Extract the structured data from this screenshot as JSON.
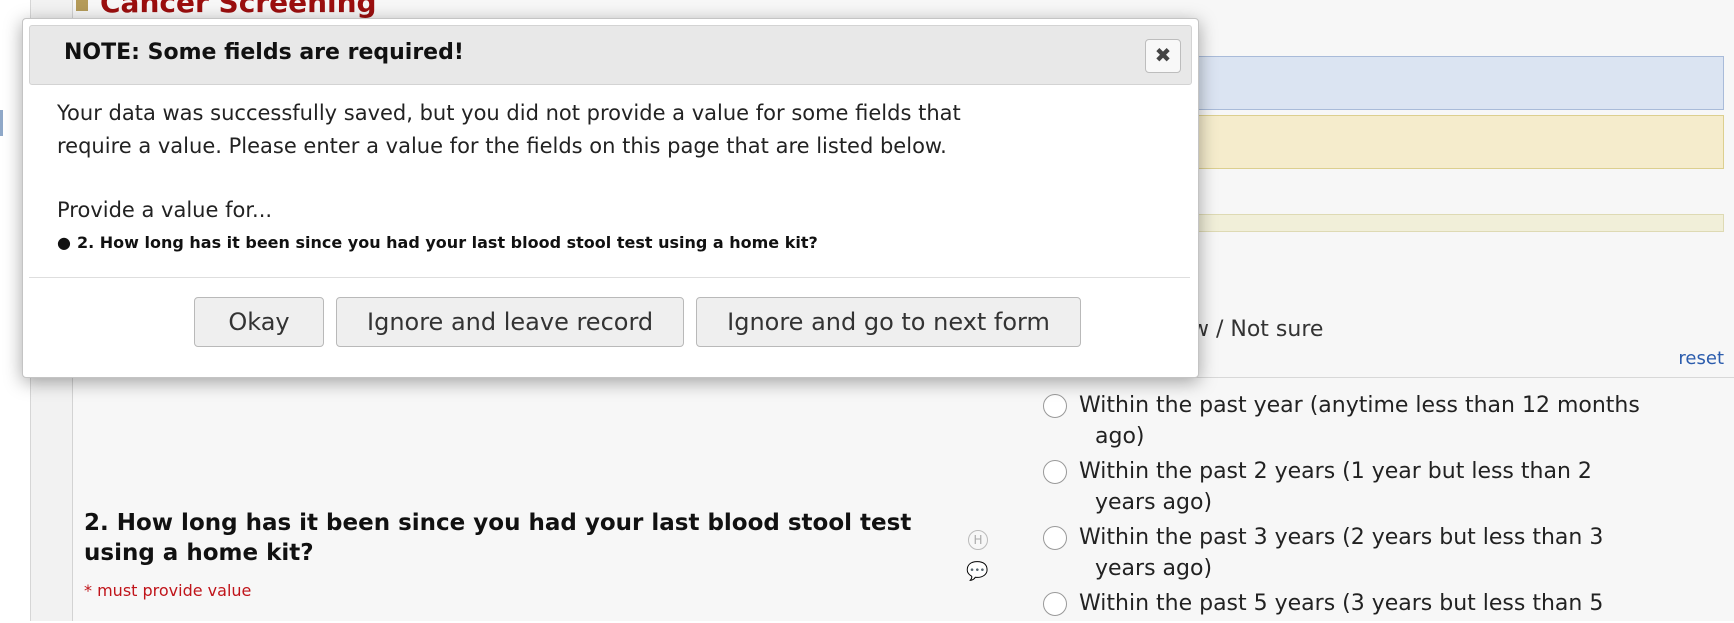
{
  "page": {
    "section_title": "Cancer Screening",
    "previous_choice_fragment": "w / Not sure",
    "reset_label": "reset"
  },
  "question": {
    "label": "2. How long has it been since you had your last blood stool test using a home kit?",
    "required_note": "* must provide value",
    "header_icon_letter": "H",
    "icons": [
      "history-icon",
      "comment-icon"
    ],
    "choices": [
      {
        "line1": "Within the past year (anytime less than 12 months",
        "line2": "ago)"
      },
      {
        "line1": "Within the past 2 years (1 year but less than 2",
        "line2": "years ago)"
      },
      {
        "line1": "Within the past 3 years (2 years but less than 3",
        "line2": "years ago)"
      },
      {
        "line1": "Within the past 5 years (3 years but less than 5",
        "line2": ""
      }
    ]
  },
  "dialog": {
    "title": "NOTE: Some fields are required!",
    "close_icon": "close-icon",
    "message_line1": "Your data was successfully saved, but you did not provide a value for some fields that",
    "message_line2": "require a value. Please enter a value for the fields on this page that are listed below.",
    "provide_label": "Provide a value for...",
    "missing_fields": [
      "2. How long has it been since you had your last blood stool test using a home kit?"
    ],
    "buttons": {
      "okay": "Okay",
      "ignore_leave": "Ignore and leave record",
      "ignore_next": "Ignore and go to next form"
    }
  },
  "colors": {
    "section_title": "#9b0f0f",
    "required_note": "#c0141a",
    "reset_link": "#2b5cad",
    "info_bar": "#dbe4f2",
    "warning_bar": "#f5eccc"
  }
}
